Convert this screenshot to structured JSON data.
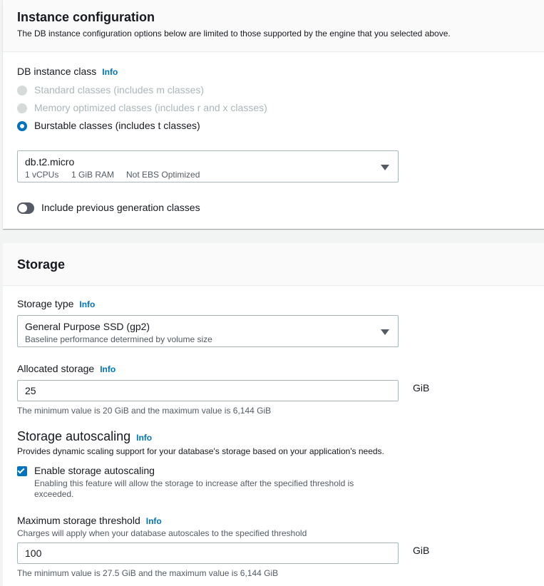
{
  "instance": {
    "title": "Instance configuration",
    "description": "The DB instance configuration options below are limited to those supported by the engine that you selected above.",
    "class_label": "DB instance class",
    "info": "Info",
    "radios": [
      {
        "label": "Standard classes (includes m classes)",
        "checked": false,
        "disabled": true
      },
      {
        "label": "Memory optimized classes (includes r and x classes)",
        "checked": false,
        "disabled": true
      },
      {
        "label": "Burstable classes (includes t classes)",
        "checked": true,
        "disabled": false
      }
    ],
    "select": {
      "value": "db.t2.micro",
      "vcpus": "1 vCPUs",
      "ram": "1 GiB RAM",
      "ebs": "Not EBS Optimized"
    },
    "toggle_label": "Include previous generation classes"
  },
  "storage": {
    "title": "Storage",
    "type_label": "Storage type",
    "info": "Info",
    "type_select": {
      "value": "General Purpose SSD (gp2)",
      "description": "Baseline performance determined by volume size"
    },
    "allocated_label": "Allocated storage",
    "allocated_value": "25",
    "unit": "GiB",
    "allocated_hint": "The minimum value is 20 GiB and the maximum value is 6,144 GiB",
    "autoscaling_title": "Storage autoscaling",
    "autoscaling_desc": "Provides dynamic scaling support for your database's storage based on your application's needs.",
    "enable_label": "Enable storage autoscaling",
    "enable_desc_line1": "Enabling this feature will allow the storage to increase after the specified threshold is",
    "enable_desc_line2": "exceeded.",
    "max_label": "Maximum storage threshold",
    "max_desc": "Charges will apply when your database autoscales to the specified threshold",
    "max_value": "100",
    "max_hint": "The minimum value is 27.5 GiB and the maximum value is 6,144 GiB"
  },
  "colors": {
    "accent": "#0073bb",
    "text": "#16191f",
    "muted": "#545b64",
    "disabled": "#aab7b8"
  }
}
